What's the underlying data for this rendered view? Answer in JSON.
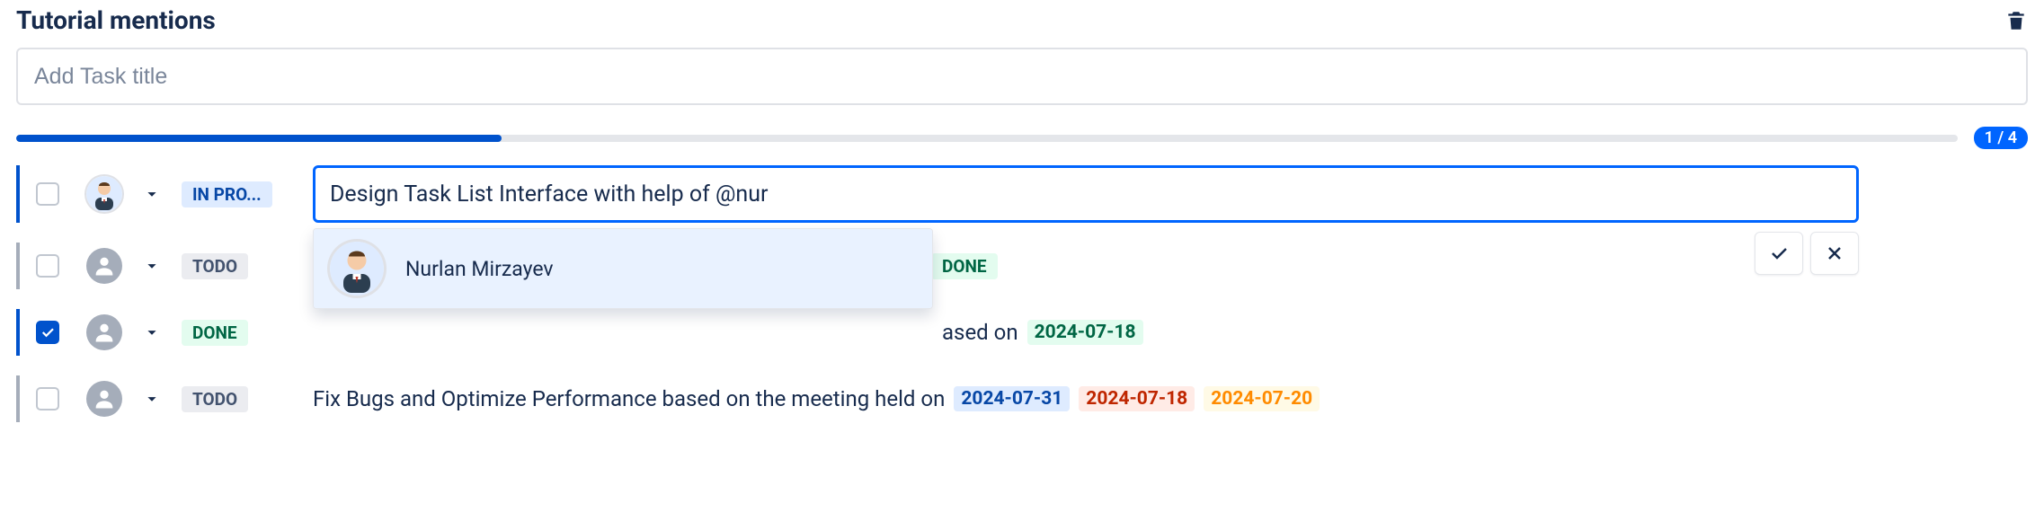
{
  "header": {
    "title": "Tutorial mentions"
  },
  "add_task": {
    "placeholder": "Add Task title",
    "value": ""
  },
  "progress": {
    "percent": 25,
    "label": "1 / 4"
  },
  "status_labels": {
    "in_progress_truncated": "IN PRO...",
    "todo": "TODO",
    "done": "DONE"
  },
  "tasks": [
    {
      "checked": false,
      "avatar": "user",
      "status_key": "in_progress_truncated",
      "editing": true,
      "edit_value": "Design Task List Interface with help of @nur"
    },
    {
      "checked": false,
      "avatar": "generic",
      "status_key": "todo",
      "covered_status_tail": "DONE"
    },
    {
      "checked": true,
      "avatar": "generic",
      "status_key": "done",
      "text_tail": "ased on",
      "dates": [
        {
          "value": "2024-07-18",
          "color": "green"
        }
      ]
    },
    {
      "checked": false,
      "avatar": "generic",
      "status_key": "todo",
      "text": "Fix Bugs and Optimize Performance based on the meeting held on",
      "dates": [
        {
          "value": "2024-07-31",
          "color": "blue"
        },
        {
          "value": "2024-07-18",
          "color": "red"
        },
        {
          "value": "2024-07-20",
          "color": "yellow"
        }
      ]
    }
  ],
  "mention_popup": {
    "visible": true,
    "items": [
      {
        "name": "Nurlan Mirzayev"
      }
    ]
  },
  "icons": {
    "trash": "trash-icon",
    "chevron_down": "chevron-down-icon",
    "check": "check-icon",
    "close": "close-icon",
    "person": "person-icon"
  }
}
